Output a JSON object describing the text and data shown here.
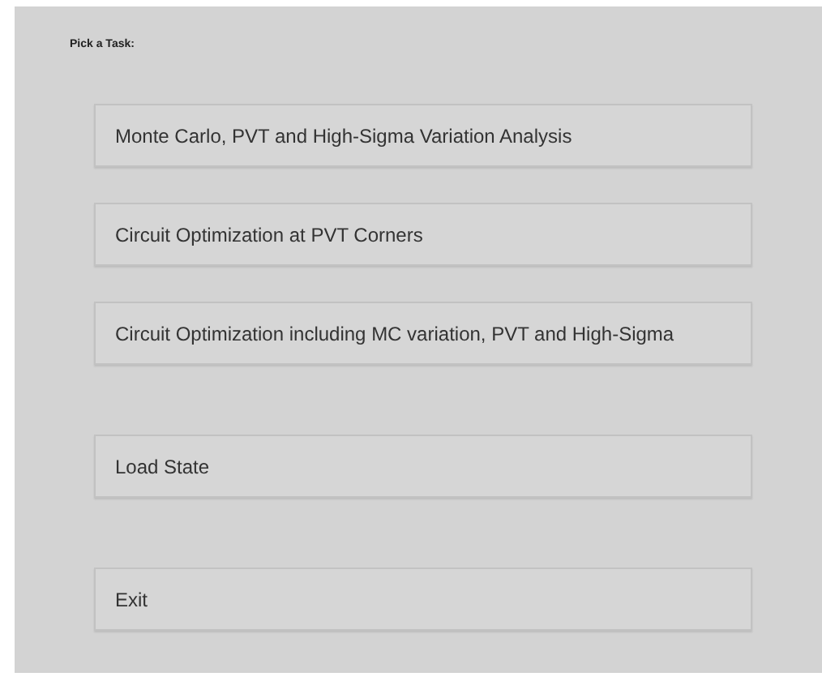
{
  "heading": "Pick a Task:",
  "tasks": [
    "Monte Carlo, PVT and High-Sigma Variation Analysis",
    "Circuit Optimization at PVT Corners",
    "Circuit Optimization including MC variation, PVT and High-Sigma"
  ],
  "actions": [
    "Load State",
    "Exit"
  ]
}
